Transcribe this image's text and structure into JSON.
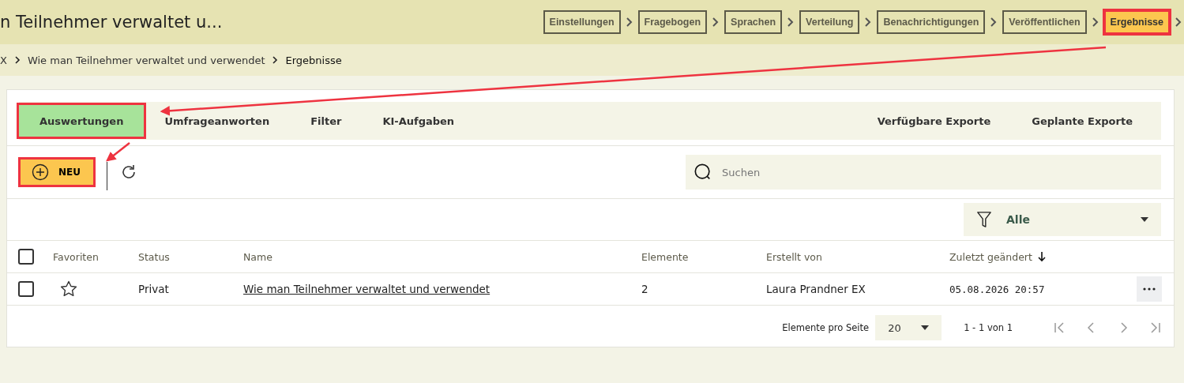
{
  "header": {
    "title": "n Teilnehmer verwaltet u...",
    "steps": [
      {
        "label": "Einstellungen",
        "selected": false,
        "highlighted": false
      },
      {
        "label": "Fragebogen",
        "selected": false,
        "highlighted": false
      },
      {
        "label": "Sprachen",
        "selected": false,
        "highlighted": false
      },
      {
        "label": "Verteilung",
        "selected": false,
        "highlighted": false
      },
      {
        "label": "Benachrichtigungen",
        "selected": false,
        "highlighted": false
      },
      {
        "label": "Veröffentlichen",
        "selected": false,
        "highlighted": false
      },
      {
        "label": "Ergebnisse",
        "selected": true,
        "highlighted": true
      }
    ]
  },
  "breadcrumb": [
    "X",
    "Wie man Teilnehmer verwaltet und verwendet",
    "Ergebnisse"
  ],
  "tabs": [
    {
      "label": "Auswertungen",
      "selected": true,
      "highlighted": true
    },
    {
      "label": "Umfrageanworten",
      "selected": false,
      "highlighted": false
    },
    {
      "label": "Filter",
      "selected": false,
      "highlighted": false
    },
    {
      "label": "KI-Aufgaben",
      "selected": false,
      "highlighted": false
    }
  ],
  "export_tabs": [
    "Verfügbare Exporte",
    "Geplante Exporte"
  ],
  "toolbar": {
    "new_button": {
      "label": "NEU",
      "highlighted": true
    },
    "search": {
      "placeholder": "Suchen"
    }
  },
  "filter": {
    "value": "Alle"
  },
  "table": {
    "all_checked": false,
    "columns": [
      {
        "label": "Favoriten",
        "sorted": false
      },
      {
        "label": "Status",
        "sorted": false
      },
      {
        "label": "Name",
        "sorted": false
      },
      {
        "label": "Elemente",
        "sorted": false
      },
      {
        "label": "Erstellt von",
        "sorted": false
      },
      {
        "label": "Zuletzt geändert",
        "sorted": true
      }
    ],
    "rows": [
      {
        "checked": false,
        "favorite": false,
        "status": "Privat",
        "name": "Wie man Teilnehmer verwaltet und verwendet",
        "elements": "2",
        "created_by": "Laura Prandner EX",
        "modified": "05.08.2026 20:57"
      }
    ]
  },
  "pagination": {
    "per_page_label": "Elemente pro Seite",
    "per_page": "20",
    "range": "1 - 1 von 1"
  }
}
